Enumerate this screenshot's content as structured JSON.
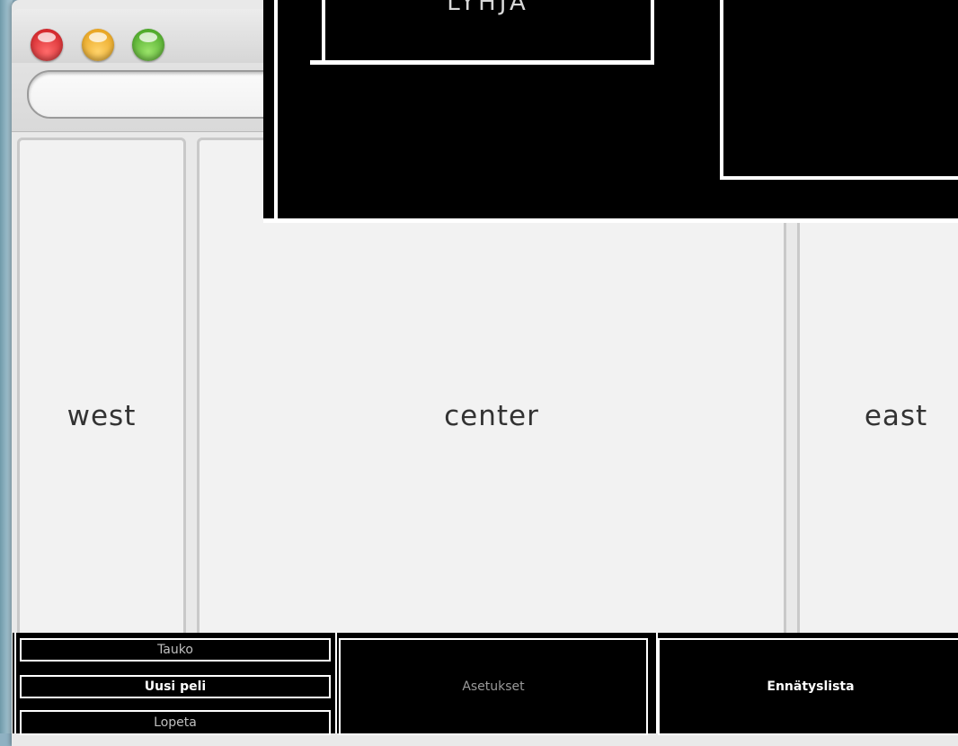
{
  "window": {
    "traffic_lights": [
      "close",
      "minimize",
      "zoom"
    ],
    "search": {
      "placeholder": "",
      "value": ""
    }
  },
  "regions": {
    "west": "west",
    "center": "center",
    "east": "east"
  },
  "overlay": {
    "label": "LYHJA"
  },
  "menu": {
    "pause_label": "Tauko",
    "new_game_label": "Uusi peli",
    "quit_label": "Lopeta",
    "settings_label": "Asetukset",
    "highscores_label": "Ennätyslista"
  },
  "colors": {
    "desktop": "#8fb1c2",
    "panel": "#f2f2f2",
    "overlay": "#000000",
    "overlay_lines": "#ffffff"
  }
}
